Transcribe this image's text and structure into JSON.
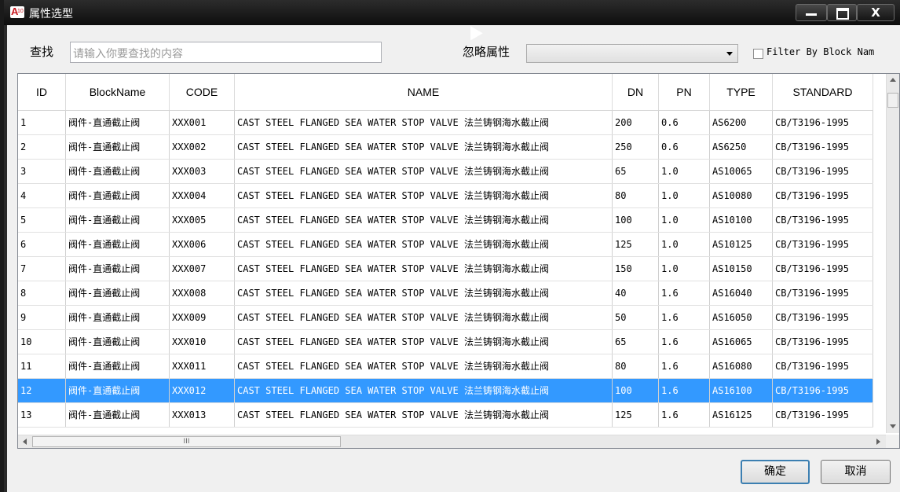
{
  "window": {
    "title": "属性选型",
    "app_icon_text": "A10"
  },
  "window_controls": {
    "minimize": "minimize",
    "maximize": "maximize",
    "close": "X"
  },
  "search": {
    "label": "查找",
    "placeholder": "请输入你要查找的内容",
    "value": ""
  },
  "ignore": {
    "label": "忽略属性",
    "value": ""
  },
  "filter": {
    "label": "Filter By Block Nam",
    "checked": false
  },
  "table": {
    "columns": [
      "ID",
      "BlockName",
      "CODE",
      "NAME",
      "DN",
      "PN",
      "TYPE",
      "STANDARD"
    ],
    "selected_row": 11,
    "rows": [
      [
        "1",
        "阀件-直通截止阀",
        "XXX001",
        "CAST STEEL FLANGED SEA WATER STOP VALVE 法兰铸钢海水截止阀",
        "200",
        "0.6",
        "AS6200",
        "CB/T3196-1995"
      ],
      [
        "2",
        "阀件-直通截止阀",
        "XXX002",
        "CAST STEEL FLANGED SEA WATER STOP VALVE 法兰铸钢海水截止阀",
        "250",
        "0.6",
        "AS6250",
        "CB/T3196-1995"
      ],
      [
        "3",
        "阀件-直通截止阀",
        "XXX003",
        "CAST STEEL FLANGED SEA WATER STOP VALVE 法兰铸钢海水截止阀",
        "65",
        "1.0",
        "AS10065",
        "CB/T3196-1995"
      ],
      [
        "4",
        "阀件-直通截止阀",
        "XXX004",
        "CAST STEEL FLANGED SEA WATER STOP VALVE 法兰铸钢海水截止阀",
        "80",
        "1.0",
        "AS10080",
        "CB/T3196-1995"
      ],
      [
        "5",
        "阀件-直通截止阀",
        "XXX005",
        "CAST STEEL FLANGED SEA WATER STOP VALVE 法兰铸钢海水截止阀",
        "100",
        "1.0",
        "AS10100",
        "CB/T3196-1995"
      ],
      [
        "6",
        "阀件-直通截止阀",
        "XXX006",
        "CAST STEEL FLANGED SEA WATER STOP VALVE 法兰铸钢海水截止阀",
        "125",
        "1.0",
        "AS10125",
        "CB/T3196-1995"
      ],
      [
        "7",
        "阀件-直通截止阀",
        "XXX007",
        "CAST STEEL FLANGED SEA WATER STOP VALVE 法兰铸钢海水截止阀",
        "150",
        "1.0",
        "AS10150",
        "CB/T3196-1995"
      ],
      [
        "8",
        "阀件-直通截止阀",
        "XXX008",
        "CAST STEEL FLANGED SEA WATER STOP VALVE 法兰铸钢海水截止阀",
        "40",
        "1.6",
        "AS16040",
        "CB/T3196-1995"
      ],
      [
        "9",
        "阀件-直通截止阀",
        "XXX009",
        "CAST STEEL FLANGED SEA WATER STOP VALVE 法兰铸钢海水截止阀",
        "50",
        "1.6",
        "AS16050",
        "CB/T3196-1995"
      ],
      [
        "10",
        "阀件-直通截止阀",
        "XXX010",
        "CAST STEEL FLANGED SEA WATER STOP VALVE 法兰铸钢海水截止阀",
        "65",
        "1.6",
        "AS16065",
        "CB/T3196-1995"
      ],
      [
        "11",
        "阀件-直通截止阀",
        "XXX011",
        "CAST STEEL FLANGED SEA WATER STOP VALVE 法兰铸钢海水截止阀",
        "80",
        "1.6",
        "AS16080",
        "CB/T3196-1995"
      ],
      [
        "12",
        "阀件-直通截止阀",
        "XXX012",
        "CAST STEEL FLANGED SEA WATER STOP VALVE 法兰铸钢海水截止阀",
        "100",
        "1.6",
        "AS16100",
        "CB/T3196-1995"
      ],
      [
        "13",
        "阀件-直通截止阀",
        "XXX013",
        "CAST STEEL FLANGED SEA WATER STOP VALVE 法兰铸钢海水截止阀",
        "125",
        "1.6",
        "AS16125",
        "CB/T3196-1995"
      ]
    ]
  },
  "hscroll": {
    "thumb_grip": "III"
  },
  "buttons": {
    "ok": "确定",
    "cancel": "取消"
  },
  "colors": {
    "selection": "#3399ff",
    "titlebar": "#111111",
    "app_icon": "#c8171e"
  }
}
